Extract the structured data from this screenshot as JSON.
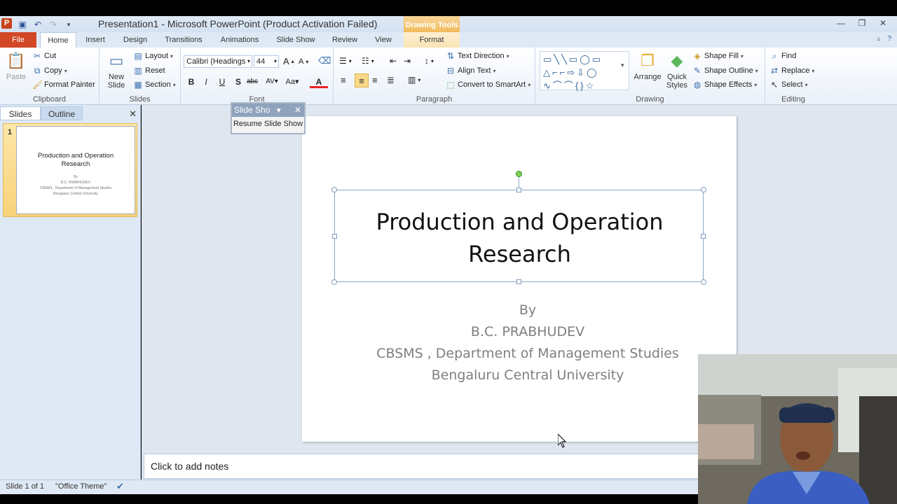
{
  "app": {
    "title": "Presentation1 - Microsoft PowerPoint (Product Activation Failed)",
    "app_icon": "P",
    "context_tab_group": "Drawing Tools"
  },
  "tabs": {
    "file": "File",
    "home": "Home",
    "insert": "Insert",
    "design": "Design",
    "transitions": "Transitions",
    "animations": "Animations",
    "slideshow": "Slide Show",
    "review": "Review",
    "view": "View",
    "format": "Format"
  },
  "ribbon": {
    "clipboard": {
      "label": "Clipboard",
      "paste": "Paste",
      "cut": "Cut",
      "copy": "Copy",
      "format_painter": "Format Painter"
    },
    "slides": {
      "label": "Slides",
      "new_slide_1": "New",
      "new_slide_2": "Slide",
      "layout": "Layout",
      "reset": "Reset",
      "section": "Section"
    },
    "font": {
      "label": "Font",
      "font_name": "Calibri (Headings",
      "font_size": "44"
    },
    "paragraph": {
      "label": "Paragraph",
      "text_direction": "Text Direction",
      "align_text": "Align Text",
      "convert_smartart": "Convert to SmartArt"
    },
    "drawing": {
      "label": "Drawing",
      "arrange": "Arrange",
      "quick_styles_1": "Quick",
      "quick_styles_2": "Styles",
      "shape_fill": "Shape Fill",
      "shape_outline": "Shape Outline",
      "shape_effects": "Shape Effects"
    },
    "editing": {
      "label": "Editing",
      "find": "Find",
      "replace": "Replace",
      "select": "Select"
    }
  },
  "left_pane": {
    "tab_slides": "Slides",
    "tab_outline": "Outline",
    "slide_number": "1",
    "thumb_title": "Production and Operation Research",
    "thumb_sub_1": "By",
    "thumb_sub_2": "B.C. PRABHUDEV",
    "thumb_sub_3": "CBSMS , Department of Management Studies",
    "thumb_sub_4": "Bengaluru Central University"
  },
  "slide": {
    "title_line_1": "Production and Operation",
    "title_line_2": "Research",
    "sub_1": "By",
    "sub_2": "B.C. PRABHUDEV",
    "sub_3": "CBSMS , Department of Management Studies",
    "sub_4": "Bengaluru Central University"
  },
  "slideshow_toolbar": {
    "title": "Slide Sho",
    "resume": "Resume Slide Show"
  },
  "notes": {
    "placeholder": "Click to add notes"
  },
  "status": {
    "slide_of": "Slide 1 of 1",
    "theme": "\"Office Theme\""
  },
  "colors": {
    "file_tab": "#d24726",
    "ribbon_bg": "#dfe9f5",
    "drawing_tools": "#f1bb5a",
    "handle_rotate": "#7ad150"
  }
}
